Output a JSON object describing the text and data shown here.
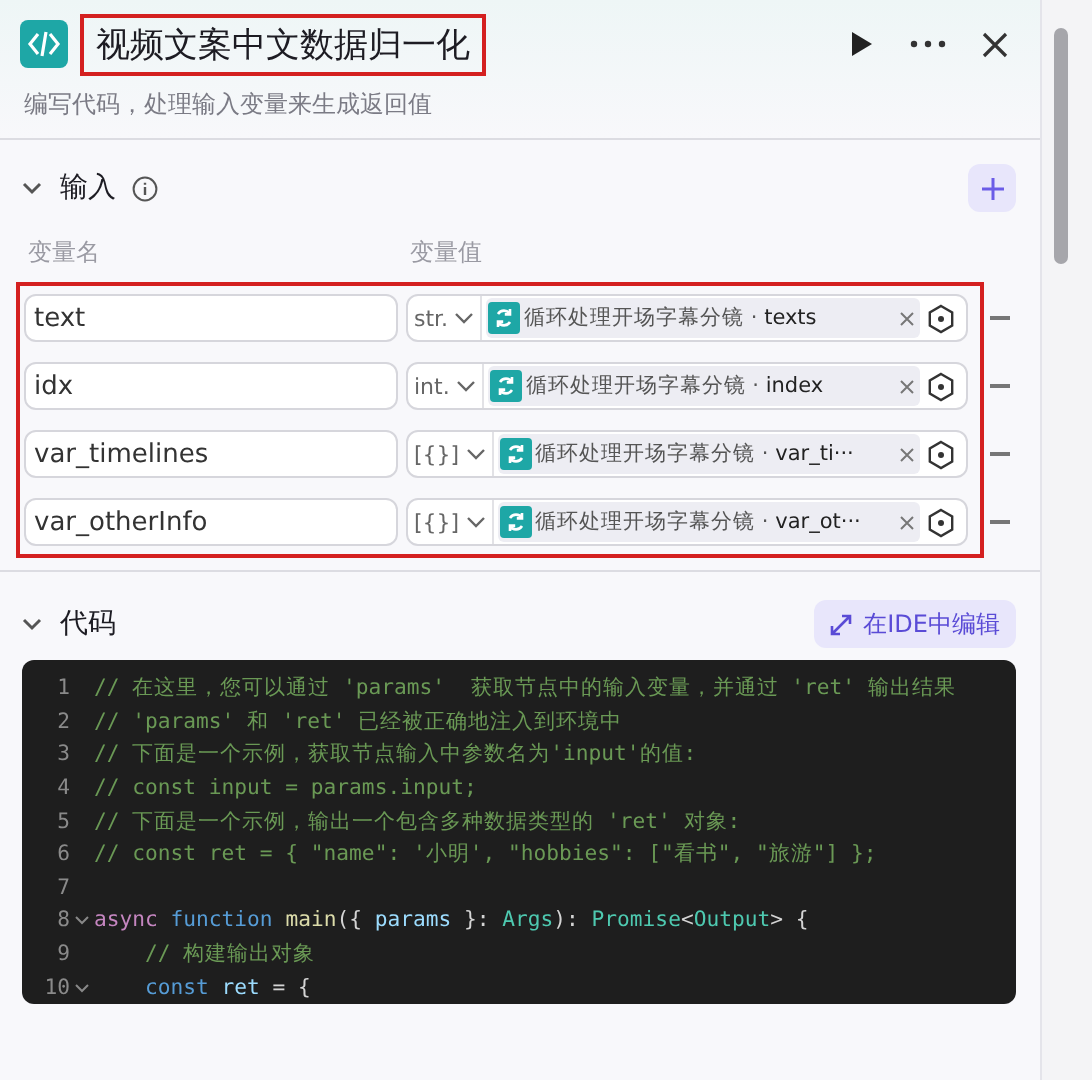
{
  "header": {
    "title": "视频文案中文数据归一化",
    "subtitle": "编写代码，处理输入变量来生成返回值",
    "title_highlighted": true
  },
  "inputs": {
    "title": "输入",
    "expanded": true,
    "columns": [
      "变量名",
      "变量值"
    ],
    "highlighted": true,
    "rows": [
      {
        "name": "text",
        "type": "str.",
        "node": "循环处理开场字幕分镜",
        "separator": "·",
        "field": "texts"
      },
      {
        "name": "idx",
        "type": "int.",
        "node": "循环处理开场字幕分镜",
        "separator": "·",
        "field": "index"
      },
      {
        "name": "var_timelines",
        "type": "[{}]",
        "node": "循环处理开场字幕分镜",
        "separator": "·",
        "field": "var_ti···"
      },
      {
        "name": "var_otherInfo",
        "type": "[{}]",
        "node": "循环处理开场字幕分镜",
        "separator": "·",
        "field": "var_ot···"
      }
    ]
  },
  "code": {
    "title": "代码",
    "expanded": true,
    "ide_button": "在IDE中编辑",
    "lines": [
      {
        "number": "1",
        "foldable": false,
        "tokens": [
          {
            "kind": "comment",
            "text": "// 在这里，您可以通过 'params'  获取节点中的输入变量，并通过 'ret' 输出结果"
          }
        ]
      },
      {
        "number": "2",
        "foldable": false,
        "tokens": [
          {
            "kind": "comment",
            "text": "// 'params' 和 'ret' 已经被正确地注入到环境中"
          }
        ]
      },
      {
        "number": "3",
        "foldable": false,
        "tokens": [
          {
            "kind": "comment",
            "text": "// 下面是一个示例，获取节点输入中参数名为'input'的值:"
          }
        ]
      },
      {
        "number": "4",
        "foldable": false,
        "tokens": [
          {
            "kind": "comment",
            "text": "// const input = params.input;"
          }
        ]
      },
      {
        "number": "5",
        "foldable": false,
        "tokens": [
          {
            "kind": "comment",
            "text": "// 下面是一个示例，输出一个包含多种数据类型的 'ret' 对象:"
          }
        ]
      },
      {
        "number": "6",
        "foldable": false,
        "tokens": [
          {
            "kind": "comment",
            "text": "// const ret = { \"name\": '小明', \"hobbies\": [\"看书\", \"旅游\"] };"
          }
        ]
      },
      {
        "number": "7",
        "foldable": false
      },
      {
        "number": "8",
        "foldable": true,
        "tokens": [
          {
            "kind": "keyword",
            "text": "async "
          },
          {
            "kind": "storage",
            "text": "function "
          },
          {
            "kind": "function",
            "text": "main"
          },
          {
            "kind": "plain",
            "text": "({ "
          },
          {
            "kind": "variable",
            "text": "params"
          },
          {
            "kind": "plain",
            "text": " }: "
          },
          {
            "kind": "type",
            "text": "Args"
          },
          {
            "kind": "plain",
            "text": "): "
          },
          {
            "kind": "type",
            "text": "Promise"
          },
          {
            "kind": "plain",
            "text": "<"
          },
          {
            "kind": "type",
            "text": "Output"
          },
          {
            "kind": "plain",
            "text": "> {"
          }
        ]
      },
      {
        "number": "9",
        "foldable": false,
        "tokens": [
          {
            "kind": "comment",
            "text": "    // 构建输出对象"
          }
        ]
      },
      {
        "number": "10",
        "foldable": true,
        "tokens": [
          {
            "kind": "storage",
            "text": "    const "
          },
          {
            "kind": "variable",
            "text": "ret"
          },
          {
            "kind": "plain",
            "text": " = {"
          }
        ]
      }
    ]
  }
}
